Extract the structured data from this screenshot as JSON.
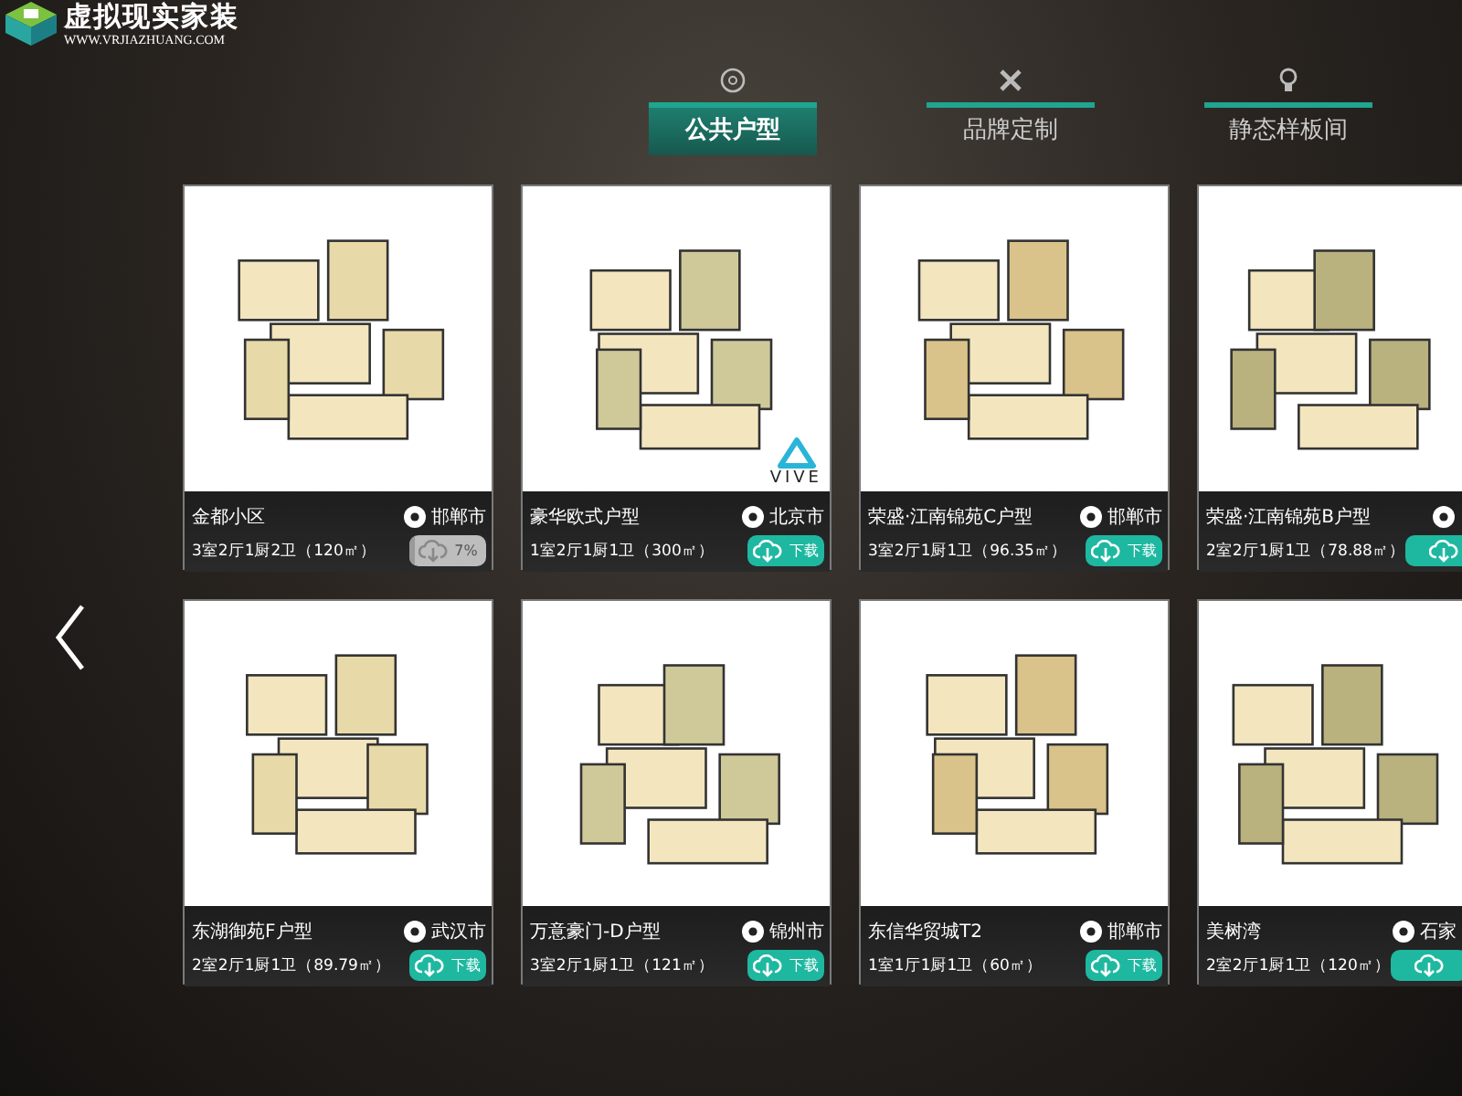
{
  "logo": {
    "title": "虚拟现实家装",
    "url": "WWW.VRJIAZHUANG.COM"
  },
  "tabs": [
    {
      "label": "公共户型",
      "selected": true
    },
    {
      "label": "品牌定制",
      "selected": false
    },
    {
      "label": "静态样板间",
      "selected": false
    }
  ],
  "cards": [
    {
      "name": "金都小区",
      "location": "邯郸市",
      "spec": "3室2厅1厨2卫（120㎡）",
      "download": {
        "kind": "progress",
        "label": "7%",
        "level": 0.07
      }
    },
    {
      "name": "豪华欧式户型",
      "location": "北京市",
      "spec": "1室2厅1厨1卫（300㎡）",
      "badge": "VIVE",
      "download": {
        "kind": "button",
        "label": "下载"
      }
    },
    {
      "name": "荣盛·江南锦苑C户型",
      "location": "邯郸市",
      "spec": "3室2厅1厨1卫（96.35㎡）",
      "download": {
        "kind": "button",
        "label": "下载"
      }
    },
    {
      "name": "荣盛·江南锦苑B户型",
      "spec": "2室2厅1厨1卫（78.88㎡）",
      "download": {
        "kind": "button"
      }
    },
    {
      "name": "东湖御苑F户型",
      "location": "武汉市",
      "spec": "2室2厅1厨1卫（89.79㎡）",
      "download": {
        "kind": "button",
        "label": "下载"
      }
    },
    {
      "name": "万意豪门-D户型",
      "location": "锦州市",
      "spec": "3室2厅1厨1卫（121㎡）",
      "download": {
        "kind": "button",
        "label": "下载"
      }
    },
    {
      "name": "东信华贸城T2",
      "location": "邯郸市",
      "spec": "1室1厅1厨1卫（60㎡）",
      "download": {
        "kind": "button",
        "label": "下载"
      }
    },
    {
      "name": "美树湾",
      "location": "石家",
      "spec": "2室2厅1厨1卫（120㎡）",
      "download": {
        "kind": "button"
      }
    }
  ]
}
